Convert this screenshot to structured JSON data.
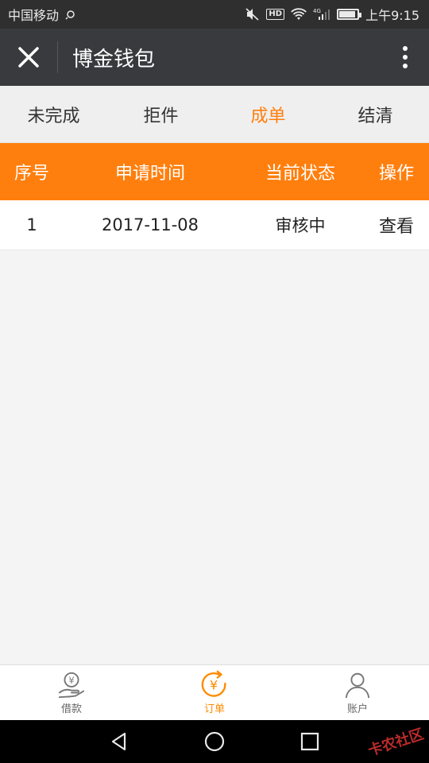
{
  "status_bar": {
    "carrier": "中国移动",
    "time": "上午9:15",
    "badge": "HD",
    "network": "4G",
    "battery_level": 0.9
  },
  "app_bar": {
    "title": "博金钱包"
  },
  "tabs": [
    {
      "label": "未完成",
      "active": false
    },
    {
      "label": "拒件",
      "active": false
    },
    {
      "label": "成单",
      "active": true
    },
    {
      "label": "结清",
      "active": false
    }
  ],
  "table": {
    "headers": [
      "序号",
      "申请时间",
      "当前状态",
      "操作"
    ],
    "rows": [
      {
        "index": "1",
        "date": "2017-11-08",
        "status": "审核中",
        "action": "查看"
      }
    ]
  },
  "bottom_nav": [
    {
      "label": "借款",
      "icon": "loan-hand-icon",
      "active": false
    },
    {
      "label": "订单",
      "icon": "yuan-refresh-icon",
      "active": true
    },
    {
      "label": "账户",
      "icon": "user-icon",
      "active": false
    }
  ],
  "watermark": "卡农社区",
  "colors": {
    "accent": "#ff7f0e",
    "appbar": "#393a3e",
    "statusbar": "#2f2f30"
  }
}
